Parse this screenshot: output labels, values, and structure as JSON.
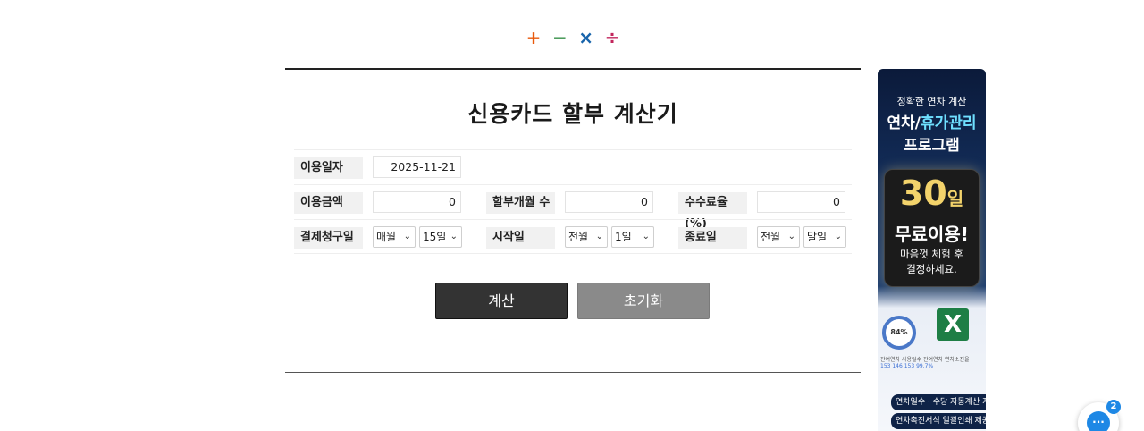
{
  "logo": {
    "plus": "+",
    "minus": "−",
    "times": "×",
    "divide": "÷"
  },
  "calculator": {
    "title": "신용카드 할부 계산기",
    "usage_date": {
      "label": "이용일자",
      "value": "2025-11-21"
    },
    "amount": {
      "label": "이용금액",
      "value": "0"
    },
    "months": {
      "label": "할부개월 수",
      "value": "0"
    },
    "fee_rate": {
      "label": "수수료율(%)",
      "value": "0"
    },
    "billing": {
      "label": "결제청구일",
      "period": "매월",
      "day": "15일"
    },
    "start": {
      "label": "시작일",
      "month": "전월",
      "day": "1일"
    },
    "end": {
      "label": "종료일",
      "month": "전월",
      "day": "말일"
    },
    "calc_button": "계산",
    "reset_button": "초기화"
  },
  "ad": {
    "line1": "정확한 연차 계산",
    "line2a": "연차/",
    "line2b": "휴가관리",
    "line3": "프로그램",
    "big": "30",
    "big_unit": "일",
    "free": "무료이용!",
    "sub1": "마음껏 체험 후",
    "sub2": "결정하세요.",
    "ring": "84%",
    "excel": "X",
    "table_text": "잔여연차 사용일수 잔여연차 연차소진율",
    "table_vals": "153 146 153 99.7%",
    "cap1": "연차일수 · 수당 자동계산 지원",
    "cap2": "연차촉진서식 일괄인쇄 제공"
  },
  "chat": {
    "icon": "chat-bubble-icon",
    "badge": "2"
  }
}
